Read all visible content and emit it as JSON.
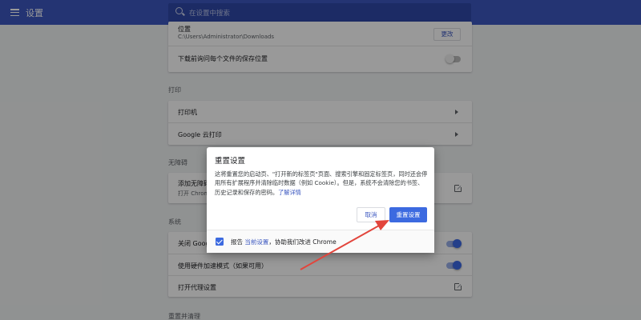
{
  "header": {
    "title": "设置",
    "search_placeholder": "在设置中搜索"
  },
  "downloads": {
    "location_label": "位置",
    "location_path": "C:\\Users\\Administrator\\Downloads",
    "change_button": "更改",
    "ask_label": "下载前询问每个文件的保存位置"
  },
  "printing": {
    "section_title": "打印",
    "printers_label": "打印机",
    "cloud_print_label": "Google 云打印"
  },
  "accessibility": {
    "section_title": "无障碍",
    "add_label": "添加无障碍",
    "add_sub": "打开 Chrom"
  },
  "system": {
    "section_title": "系统",
    "close_label": "关闭 Googl",
    "hw_accel_label": "使用硬件加速模式（如果可用）",
    "proxy_label": "打开代理设置"
  },
  "reset_section": {
    "section_title": "重置并清理"
  },
  "dialog": {
    "title": "重置设置",
    "body": "这将重置您的启动页、\"打开新的标签页\"页面、搜索引擎和固定标签页，同时还会停用所有扩展程序并清除临时数据（例如 Cookie）。但是，系统不会清除您的书签、历史记录和保存的密码。",
    "learn_more": "了解详情",
    "cancel_button": "取消",
    "reset_button": "重置设置",
    "report_prefix": "报告",
    "report_link": "当前设置",
    "report_suffix": "，协助我们改进 Chrome",
    "report_checked": true
  },
  "colors": {
    "header_blue": "#3c58c0",
    "primary_button": "#3c6ae0",
    "annotation_arrow": "#e2453c"
  }
}
